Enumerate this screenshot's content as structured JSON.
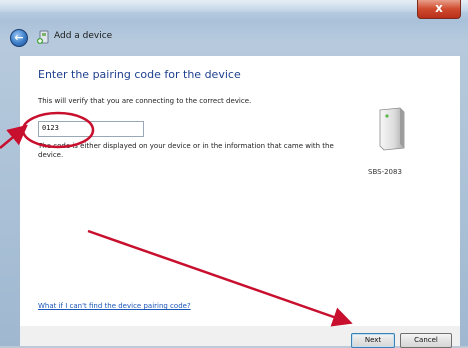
{
  "window": {
    "close_glyph": "x"
  },
  "header": {
    "title": "Add a device",
    "back_glyph": "←"
  },
  "dialog": {
    "heading": "Enter the pairing code for the device",
    "description": "This will verify that you are connecting to the correct device.",
    "code_value": "0123",
    "help_text": "The code is either displayed on your device or in the information that came with the device.",
    "device_name": "SBS-2083",
    "help_link": "What if I can't find the device pairing code?"
  },
  "footer": {
    "next_label": "Next",
    "cancel_label": "Cancel"
  },
  "colors": {
    "heading": "#1e3f8f",
    "annotation": "#c8102e",
    "link": "#1a55b8"
  }
}
